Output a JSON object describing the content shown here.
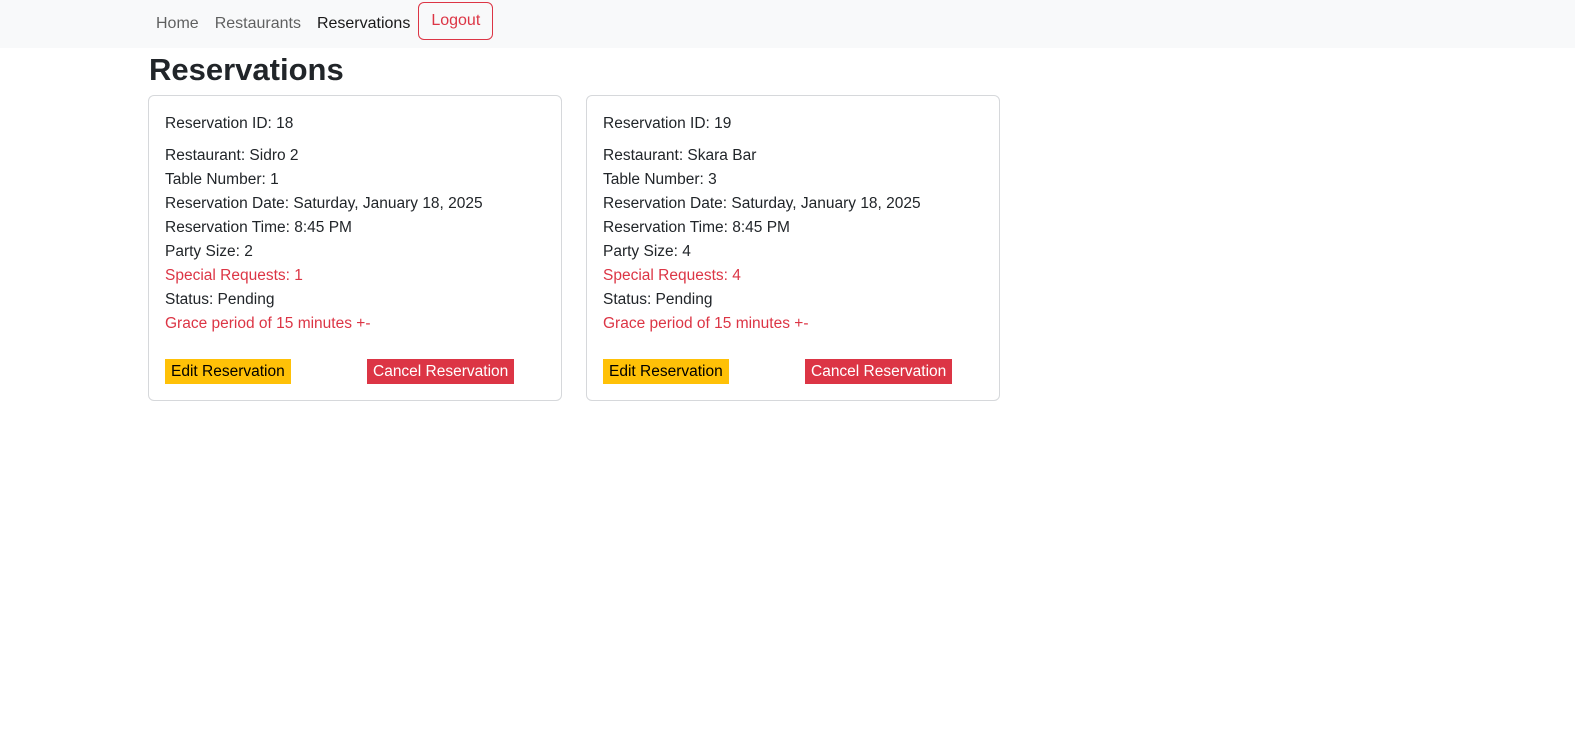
{
  "nav": {
    "links": [
      {
        "label": "Home"
      },
      {
        "label": "Restaurants"
      },
      {
        "label": "Reservations"
      }
    ],
    "logout_label": "Logout"
  },
  "page": {
    "title": "Reservations"
  },
  "colors": {
    "danger": "#dc3545",
    "warning": "#ffc107",
    "navbar_bg": "#f8f9fa"
  },
  "reservations": [
    {
      "id_line": "Reservation ID: 18",
      "restaurant": "Restaurant: Sidro 2",
      "table": "Table Number: 1",
      "date": "Reservation Date: Saturday, January 18, 2025",
      "time": "Reservation Time: 8:45 PM",
      "party": "Party Size: 2",
      "requests": "Special Requests: 1",
      "status": "Status: Pending",
      "grace": "Grace period of 15 minutes +-",
      "edit_label": "Edit Reservation",
      "cancel_label": "Cancel Reservation"
    },
    {
      "id_line": "Reservation ID: 19",
      "restaurant": "Restaurant: Skara Bar",
      "table": "Table Number: 3",
      "date": "Reservation Date: Saturday, January 18, 2025",
      "time": "Reservation Time: 8:45 PM",
      "party": "Party Size: 4",
      "requests": "Special Requests: 4",
      "status": "Status: Pending",
      "grace": "Grace period of 15 minutes +-",
      "edit_label": "Edit Reservation",
      "cancel_label": "Cancel Reservation"
    }
  ]
}
